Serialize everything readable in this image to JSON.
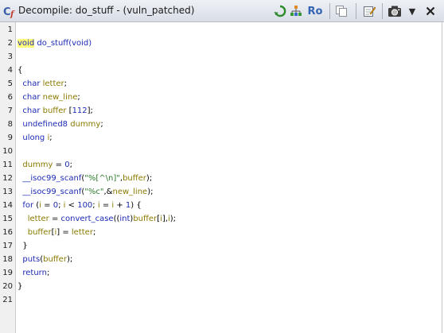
{
  "window": {
    "title": "Decompile: do_stuff -  (vuln_patched)",
    "app_icon": "decompile-cf-icon",
    "toolbar": [
      {
        "name": "refresh-icon",
        "label": ""
      },
      {
        "name": "export-graph-icon",
        "label": ""
      },
      {
        "name": "read-only-toggle",
        "label": "Ro"
      },
      {
        "name": "copy-icon",
        "label": ""
      },
      {
        "name": "edit-icon",
        "label": ""
      },
      {
        "name": "snapshot-icon",
        "label": ""
      },
      {
        "name": "menu-chevron-down-icon",
        "label": "▼"
      },
      {
        "name": "close-icon",
        "label": ""
      }
    ]
  },
  "code": {
    "colors": {
      "keyword": "#1d2bb4",
      "variable": "#8a7a00",
      "string": "#2a7a2a",
      "highlight": "#fffb7a"
    },
    "lines": [
      {
        "n": "1",
        "tokens": []
      },
      {
        "n": "2",
        "tokens": [
          [
            "kw-hl",
            "void"
          ],
          [
            "fn",
            " do_stuff"
          ],
          [
            "kw",
            "(void)"
          ]
        ]
      },
      {
        "n": "3",
        "tokens": []
      },
      {
        "n": "4",
        "tokens": [
          [
            "pun",
            "{"
          ]
        ]
      },
      {
        "n": "5",
        "tokens": [
          [
            "kw",
            "  char "
          ],
          [
            "var",
            "letter"
          ],
          [
            "pun",
            ";"
          ]
        ]
      },
      {
        "n": "6",
        "tokens": [
          [
            "kw",
            "  char "
          ],
          [
            "var",
            "new_line"
          ],
          [
            "pun",
            ";"
          ]
        ]
      },
      {
        "n": "7",
        "tokens": [
          [
            "kw",
            "  char "
          ],
          [
            "var",
            "buffer "
          ],
          [
            "pun",
            "["
          ],
          [
            "num",
            "112"
          ],
          [
            "pun",
            "];"
          ]
        ]
      },
      {
        "n": "8",
        "tokens": [
          [
            "kw",
            "  undefined8 "
          ],
          [
            "var",
            "dummy"
          ],
          [
            "pun",
            ";"
          ]
        ]
      },
      {
        "n": "9",
        "tokens": [
          [
            "kw",
            "  ulong "
          ],
          [
            "var",
            "i"
          ],
          [
            "pun",
            ";"
          ]
        ]
      },
      {
        "n": "10",
        "tokens": []
      },
      {
        "n": "11",
        "tokens": [
          [
            "var",
            "  dummy"
          ],
          [
            "pun",
            " = "
          ],
          [
            "num",
            "0"
          ],
          [
            "pun",
            ";"
          ]
        ]
      },
      {
        "n": "12",
        "tokens": [
          [
            "fn",
            "  __isoc99_scanf"
          ],
          [
            "pun",
            "("
          ],
          [
            "str",
            "\"%[^\\n]\""
          ],
          [
            "pun",
            ","
          ],
          [
            "var",
            "buffer"
          ],
          [
            "pun",
            ");"
          ]
        ]
      },
      {
        "n": "13",
        "tokens": [
          [
            "fn",
            "  __isoc99_scanf"
          ],
          [
            "pun",
            "("
          ],
          [
            "str",
            "\"%c\""
          ],
          [
            "pun",
            ",&"
          ],
          [
            "var",
            "new_line"
          ],
          [
            "pun",
            ");"
          ]
        ]
      },
      {
        "n": "14",
        "tokens": [
          [
            "kw",
            "  for "
          ],
          [
            "pun",
            "("
          ],
          [
            "var",
            "i"
          ],
          [
            "pun",
            " = "
          ],
          [
            "num",
            "0"
          ],
          [
            "pun",
            "; "
          ],
          [
            "var",
            "i"
          ],
          [
            "pun",
            " < "
          ],
          [
            "num",
            "100"
          ],
          [
            "pun",
            "; "
          ],
          [
            "var",
            "i"
          ],
          [
            "pun",
            " = "
          ],
          [
            "var",
            "i"
          ],
          [
            "pun",
            " + "
          ],
          [
            "num",
            "1"
          ],
          [
            "pun",
            ") {"
          ]
        ]
      },
      {
        "n": "15",
        "tokens": [
          [
            "var",
            "    letter"
          ],
          [
            "pun",
            " = "
          ],
          [
            "fn",
            "convert_case"
          ],
          [
            "pun",
            "(("
          ],
          [
            "kw",
            "int"
          ],
          [
            "pun",
            ")"
          ],
          [
            "var",
            "buffer"
          ],
          [
            "pun",
            "["
          ],
          [
            "var",
            "i"
          ],
          [
            "pun",
            "],"
          ],
          [
            "var",
            "i"
          ],
          [
            "pun",
            ");"
          ]
        ]
      },
      {
        "n": "16",
        "tokens": [
          [
            "var",
            "    buffer"
          ],
          [
            "pun",
            "["
          ],
          [
            "var",
            "i"
          ],
          [
            "pun",
            "] = "
          ],
          [
            "var",
            "letter"
          ],
          [
            "pun",
            ";"
          ]
        ]
      },
      {
        "n": "17",
        "tokens": [
          [
            "pun",
            "  }"
          ]
        ]
      },
      {
        "n": "18",
        "tokens": [
          [
            "fn",
            "  puts"
          ],
          [
            "pun",
            "("
          ],
          [
            "var",
            "buffer"
          ],
          [
            "pun",
            ");"
          ]
        ]
      },
      {
        "n": "19",
        "tokens": [
          [
            "kw",
            "  return"
          ],
          [
            "pun",
            ";"
          ]
        ]
      },
      {
        "n": "20",
        "tokens": [
          [
            "pun",
            "}"
          ]
        ]
      },
      {
        "n": "21",
        "tokens": []
      }
    ]
  }
}
